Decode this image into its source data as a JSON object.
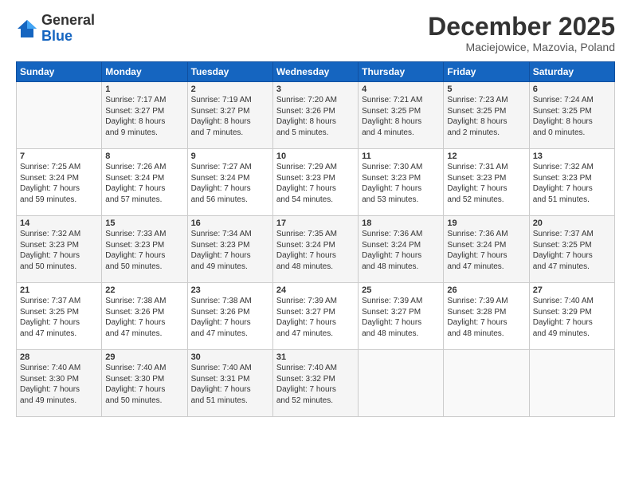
{
  "logo": {
    "general": "General",
    "blue": "Blue"
  },
  "header": {
    "title": "December 2025",
    "location": "Maciejowice, Mazovia, Poland"
  },
  "weekdays": [
    "Sunday",
    "Monday",
    "Tuesday",
    "Wednesday",
    "Thursday",
    "Friday",
    "Saturday"
  ],
  "weeks": [
    [
      {
        "day": "",
        "info": ""
      },
      {
        "day": "1",
        "info": "Sunrise: 7:17 AM\nSunset: 3:27 PM\nDaylight: 8 hours\nand 9 minutes."
      },
      {
        "day": "2",
        "info": "Sunrise: 7:19 AM\nSunset: 3:27 PM\nDaylight: 8 hours\nand 7 minutes."
      },
      {
        "day": "3",
        "info": "Sunrise: 7:20 AM\nSunset: 3:26 PM\nDaylight: 8 hours\nand 5 minutes."
      },
      {
        "day": "4",
        "info": "Sunrise: 7:21 AM\nSunset: 3:25 PM\nDaylight: 8 hours\nand 4 minutes."
      },
      {
        "day": "5",
        "info": "Sunrise: 7:23 AM\nSunset: 3:25 PM\nDaylight: 8 hours\nand 2 minutes."
      },
      {
        "day": "6",
        "info": "Sunrise: 7:24 AM\nSunset: 3:25 PM\nDaylight: 8 hours\nand 0 minutes."
      }
    ],
    [
      {
        "day": "7",
        "info": "Sunrise: 7:25 AM\nSunset: 3:24 PM\nDaylight: 7 hours\nand 59 minutes."
      },
      {
        "day": "8",
        "info": "Sunrise: 7:26 AM\nSunset: 3:24 PM\nDaylight: 7 hours\nand 57 minutes."
      },
      {
        "day": "9",
        "info": "Sunrise: 7:27 AM\nSunset: 3:24 PM\nDaylight: 7 hours\nand 56 minutes."
      },
      {
        "day": "10",
        "info": "Sunrise: 7:29 AM\nSunset: 3:23 PM\nDaylight: 7 hours\nand 54 minutes."
      },
      {
        "day": "11",
        "info": "Sunrise: 7:30 AM\nSunset: 3:23 PM\nDaylight: 7 hours\nand 53 minutes."
      },
      {
        "day": "12",
        "info": "Sunrise: 7:31 AM\nSunset: 3:23 PM\nDaylight: 7 hours\nand 52 minutes."
      },
      {
        "day": "13",
        "info": "Sunrise: 7:32 AM\nSunset: 3:23 PM\nDaylight: 7 hours\nand 51 minutes."
      }
    ],
    [
      {
        "day": "14",
        "info": "Sunrise: 7:32 AM\nSunset: 3:23 PM\nDaylight: 7 hours\nand 50 minutes."
      },
      {
        "day": "15",
        "info": "Sunrise: 7:33 AM\nSunset: 3:23 PM\nDaylight: 7 hours\nand 50 minutes."
      },
      {
        "day": "16",
        "info": "Sunrise: 7:34 AM\nSunset: 3:23 PM\nDaylight: 7 hours\nand 49 minutes."
      },
      {
        "day": "17",
        "info": "Sunrise: 7:35 AM\nSunset: 3:24 PM\nDaylight: 7 hours\nand 48 minutes."
      },
      {
        "day": "18",
        "info": "Sunrise: 7:36 AM\nSunset: 3:24 PM\nDaylight: 7 hours\nand 48 minutes."
      },
      {
        "day": "19",
        "info": "Sunrise: 7:36 AM\nSunset: 3:24 PM\nDaylight: 7 hours\nand 47 minutes."
      },
      {
        "day": "20",
        "info": "Sunrise: 7:37 AM\nSunset: 3:25 PM\nDaylight: 7 hours\nand 47 minutes."
      }
    ],
    [
      {
        "day": "21",
        "info": "Sunrise: 7:37 AM\nSunset: 3:25 PM\nDaylight: 7 hours\nand 47 minutes."
      },
      {
        "day": "22",
        "info": "Sunrise: 7:38 AM\nSunset: 3:26 PM\nDaylight: 7 hours\nand 47 minutes."
      },
      {
        "day": "23",
        "info": "Sunrise: 7:38 AM\nSunset: 3:26 PM\nDaylight: 7 hours\nand 47 minutes."
      },
      {
        "day": "24",
        "info": "Sunrise: 7:39 AM\nSunset: 3:27 PM\nDaylight: 7 hours\nand 47 minutes."
      },
      {
        "day": "25",
        "info": "Sunrise: 7:39 AM\nSunset: 3:27 PM\nDaylight: 7 hours\nand 48 minutes."
      },
      {
        "day": "26",
        "info": "Sunrise: 7:39 AM\nSunset: 3:28 PM\nDaylight: 7 hours\nand 48 minutes."
      },
      {
        "day": "27",
        "info": "Sunrise: 7:40 AM\nSunset: 3:29 PM\nDaylight: 7 hours\nand 49 minutes."
      }
    ],
    [
      {
        "day": "28",
        "info": "Sunrise: 7:40 AM\nSunset: 3:30 PM\nDaylight: 7 hours\nand 49 minutes."
      },
      {
        "day": "29",
        "info": "Sunrise: 7:40 AM\nSunset: 3:30 PM\nDaylight: 7 hours\nand 50 minutes."
      },
      {
        "day": "30",
        "info": "Sunrise: 7:40 AM\nSunset: 3:31 PM\nDaylight: 7 hours\nand 51 minutes."
      },
      {
        "day": "31",
        "info": "Sunrise: 7:40 AM\nSunset: 3:32 PM\nDaylight: 7 hours\nand 52 minutes."
      },
      {
        "day": "",
        "info": ""
      },
      {
        "day": "",
        "info": ""
      },
      {
        "day": "",
        "info": ""
      }
    ]
  ]
}
